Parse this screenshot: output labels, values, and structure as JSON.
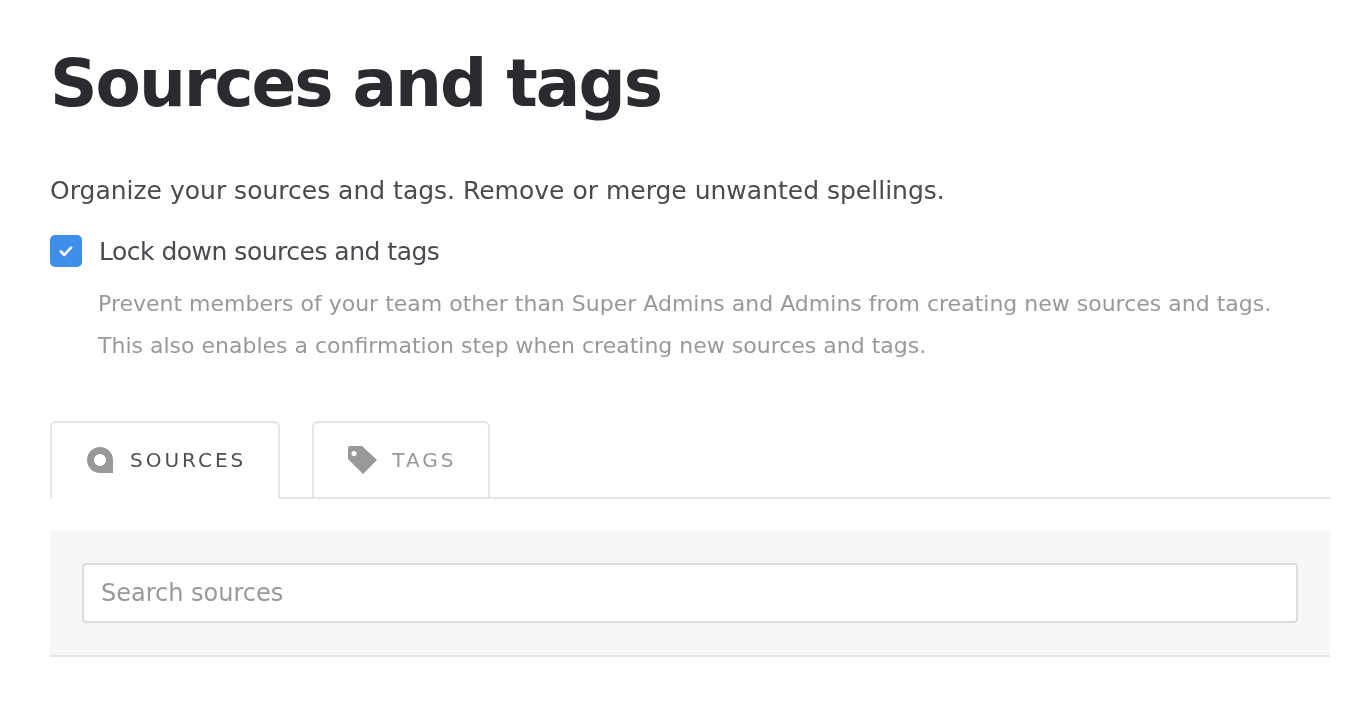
{
  "page": {
    "title": "Sources and tags",
    "description": "Organize your sources and tags. Remove or merge unwanted spellings."
  },
  "lock": {
    "label": "Lock down sources and tags",
    "checked": true,
    "help": "Prevent members of your team other than Super Admins and Admins from creating new sources and tags. This also enables a confirmation step when creating new sources and tags."
  },
  "tabs": [
    {
      "kind": "sources",
      "label": "SOURCES",
      "selected": true
    },
    {
      "kind": "tags",
      "label": "TAGS",
      "selected": false
    }
  ],
  "search": {
    "placeholder": "Search sources"
  }
}
